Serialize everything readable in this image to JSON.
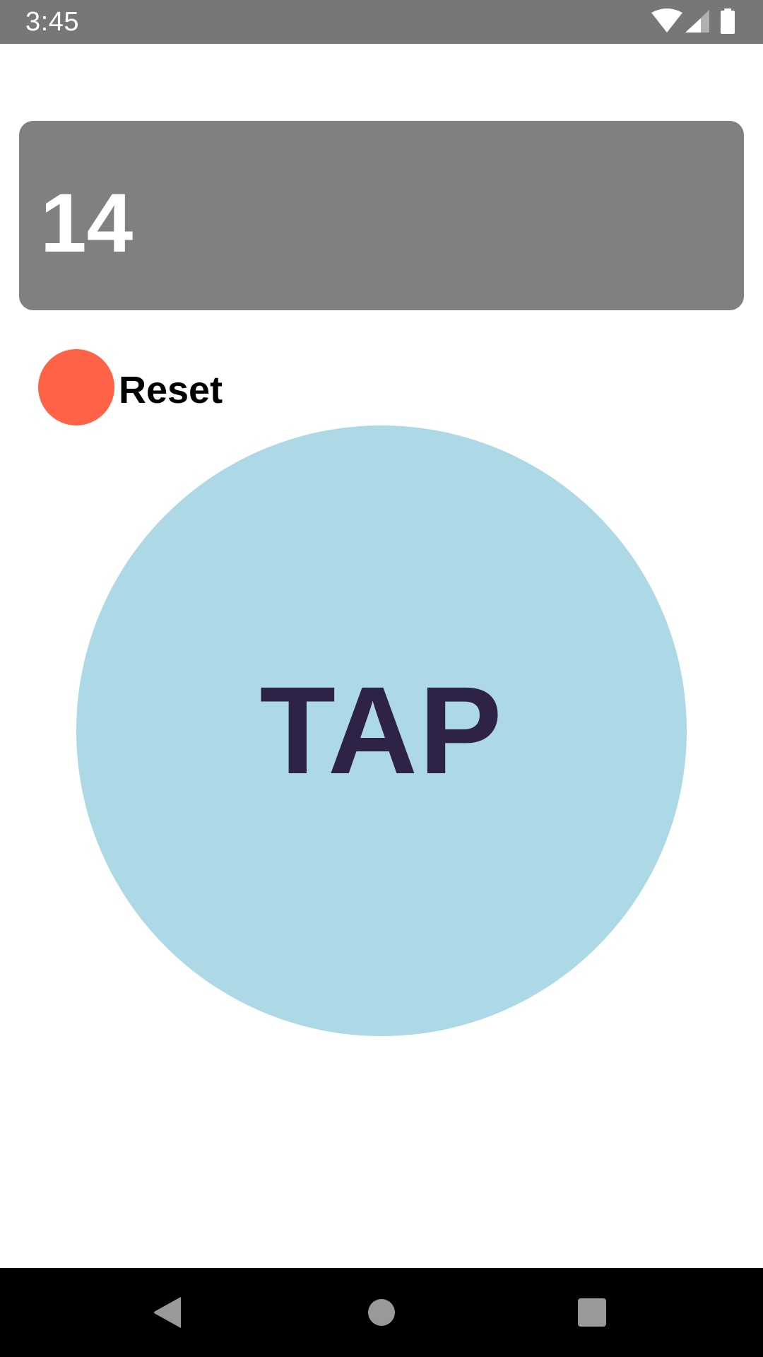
{
  "status_bar": {
    "time": "3:45",
    "icons": [
      "wifi-icon",
      "cell-signal-icon",
      "battery-icon"
    ]
  },
  "counter": {
    "value": "14"
  },
  "reset": {
    "label": "Reset"
  },
  "tap_button": {
    "label": "TAP"
  },
  "nav_bar": {
    "buttons": [
      "back-icon",
      "home-icon",
      "recents-icon"
    ]
  },
  "colors": {
    "status_bar": "#777777",
    "counter_panel": "#808080",
    "counter_text": "#FFFFFF",
    "reset_dot": "#FF6347",
    "tap_circle": "#ADD8E6",
    "tap_text": "#2E2347",
    "nav_bar": "#000000",
    "nav_icons": "#999999"
  }
}
